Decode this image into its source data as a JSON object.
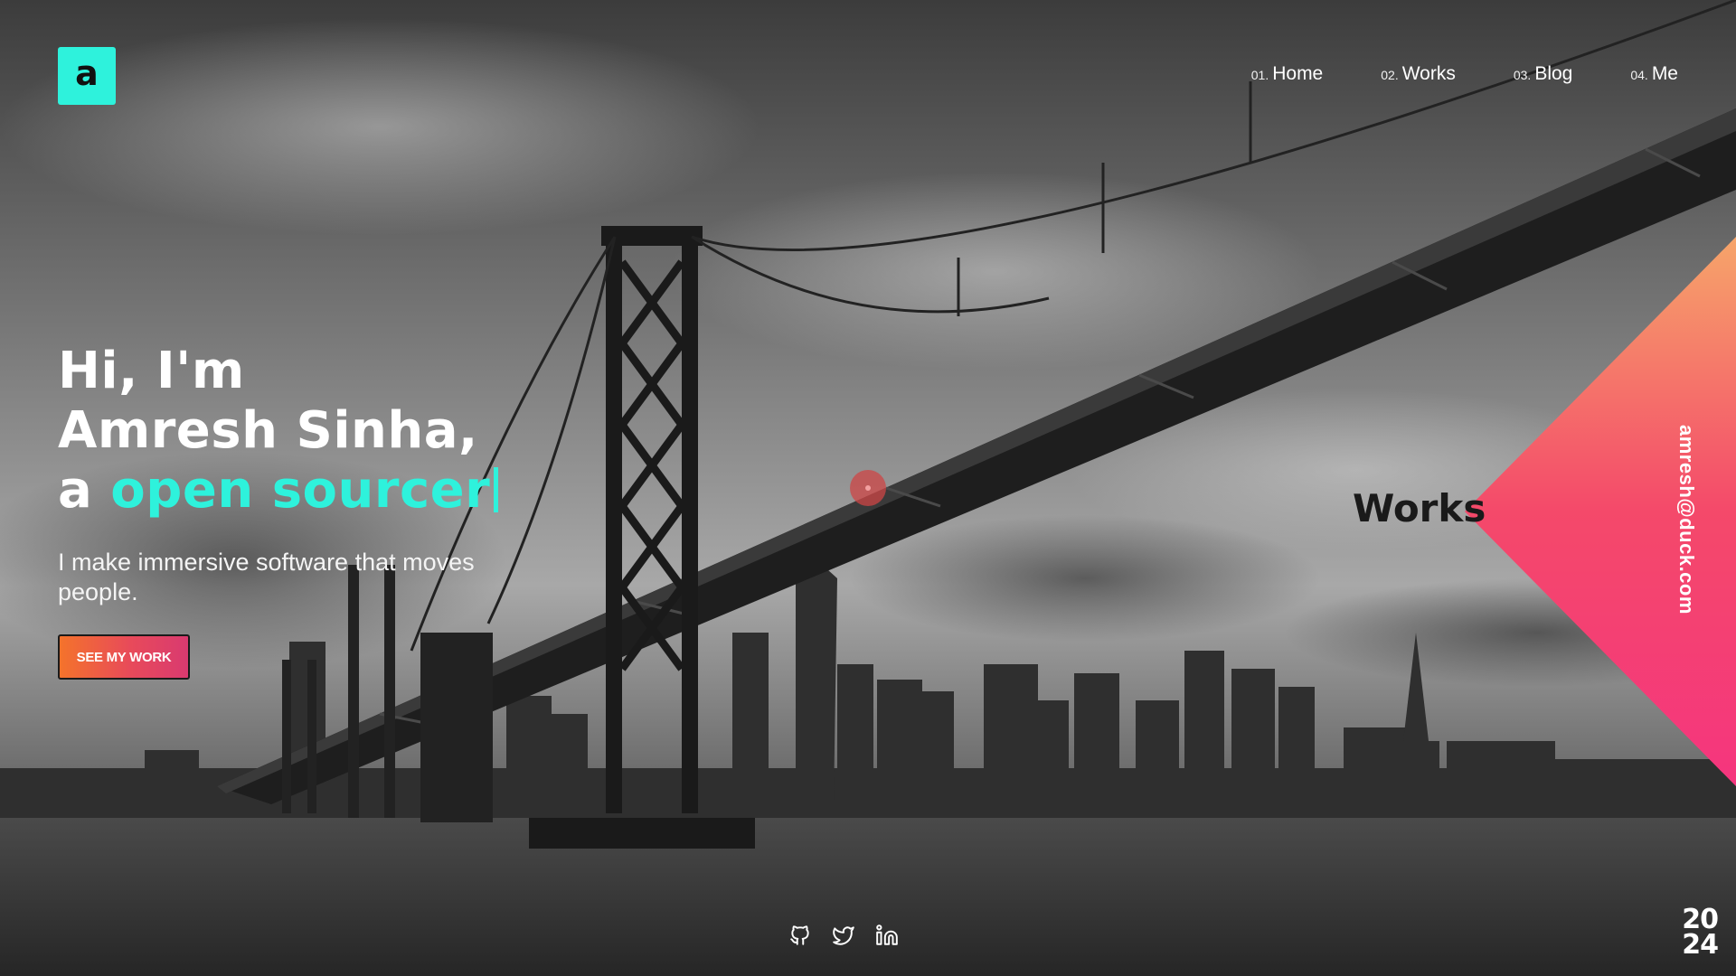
{
  "logo": {
    "letter": "a"
  },
  "nav": {
    "items": [
      {
        "num": "01.",
        "label": "Home"
      },
      {
        "num": "02.",
        "label": "Works"
      },
      {
        "num": "03.",
        "label": "Blog"
      },
      {
        "num": "04.",
        "label": "Me"
      }
    ]
  },
  "hero": {
    "line1": "Hi, I'm",
    "line2": "Amresh Sinha,",
    "line3_prefix": "a",
    "role": "open sourcer",
    "subtitle": "I make immersive software that moves people.",
    "cta_label": "SEE MY WORK"
  },
  "side_panel": {
    "label": "Works",
    "email": "amresh@duck.com"
  },
  "socials": [
    "github-icon",
    "twitter-icon",
    "linkedin-icon"
  ],
  "year": {
    "top": "20",
    "bottom": "24"
  },
  "colors": {
    "accent": "#2ef2dc",
    "cta_start": "#f4732b",
    "cta_end": "#d93a70",
    "triangle_top": "#f6a06a",
    "triangle_bottom": "#f5357e"
  }
}
